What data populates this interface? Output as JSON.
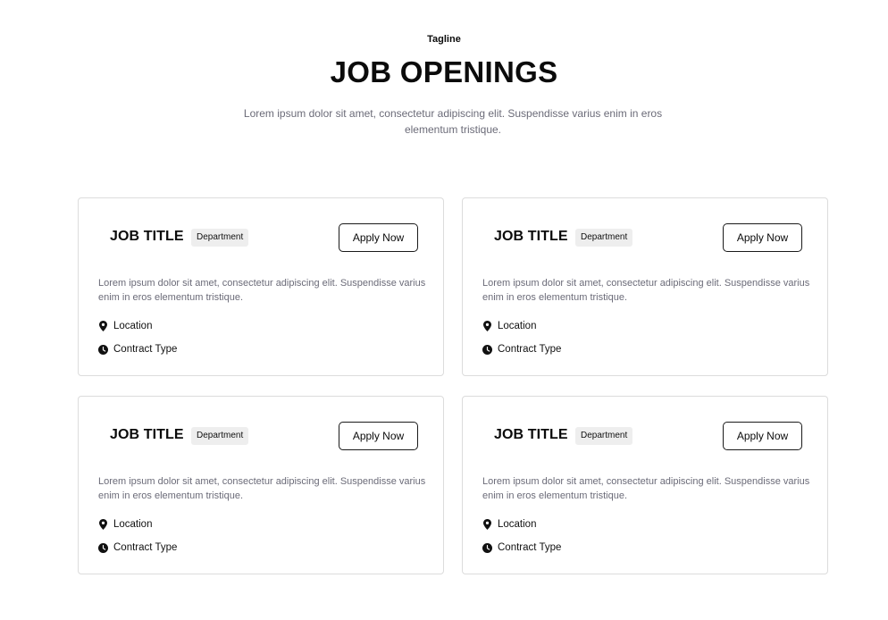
{
  "header": {
    "tagline": "Tagline",
    "title": "JOB OPENINGS",
    "intro": "Lorem ipsum dolor sit amet, consectetur adipiscing elit. Suspendisse varius enim in eros elementum tristique."
  },
  "jobs": [
    {
      "title": "JOB TITLE",
      "department": "Department",
      "apply_label": "Apply Now",
      "description": "Lorem ipsum dolor sit amet, consectetur adipiscing elit. Suspendisse varius enim in eros elementum tristique.",
      "location": "Location",
      "contract": "Contract Type"
    },
    {
      "title": "JOB TITLE",
      "department": "Department",
      "apply_label": "Apply Now",
      "description": "Lorem ipsum dolor sit amet, consectetur adipiscing elit. Suspendisse varius enim in eros elementum tristique.",
      "location": "Location",
      "contract": "Contract Type"
    },
    {
      "title": "JOB TITLE",
      "department": "Department",
      "apply_label": "Apply Now",
      "description": "Lorem ipsum dolor sit amet, consectetur adipiscing elit. Suspendisse varius enim in eros elementum tristique.",
      "location": "Location",
      "contract": "Contract Type"
    },
    {
      "title": "JOB TITLE",
      "department": "Department",
      "apply_label": "Apply Now",
      "description": "Lorem ipsum dolor sit amet, consectetur adipiscing elit. Suspendisse varius enim in eros elementum tristique.",
      "location": "Location",
      "contract": "Contract Type"
    }
  ],
  "icons": {
    "location": "map-pin-icon",
    "contract": "clock-icon"
  },
  "colors": {
    "text": "#0b0b0b",
    "muted": "#6b6b78",
    "border": "#dcdcdc",
    "badge_bg": "#eeeeee"
  }
}
